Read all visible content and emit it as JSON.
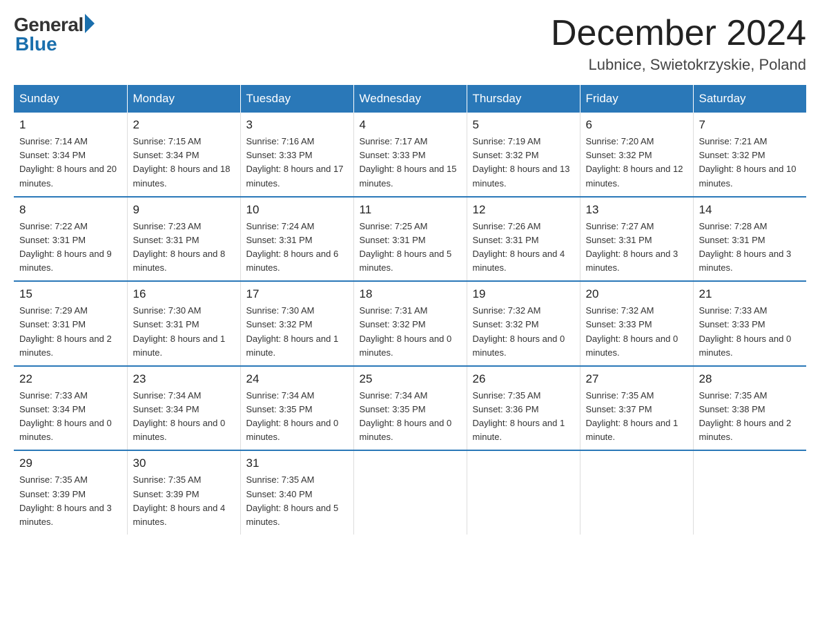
{
  "header": {
    "logo_general": "General",
    "logo_blue": "Blue",
    "title": "December 2024",
    "subtitle": "Lubnice, Swietokrzyskie, Poland"
  },
  "days_of_week": [
    "Sunday",
    "Monday",
    "Tuesday",
    "Wednesday",
    "Thursday",
    "Friday",
    "Saturday"
  ],
  "weeks": [
    [
      {
        "day": "1",
        "sunrise": "7:14 AM",
        "sunset": "3:34 PM",
        "daylight": "8 hours and 20 minutes."
      },
      {
        "day": "2",
        "sunrise": "7:15 AM",
        "sunset": "3:34 PM",
        "daylight": "8 hours and 18 minutes."
      },
      {
        "day": "3",
        "sunrise": "7:16 AM",
        "sunset": "3:33 PM",
        "daylight": "8 hours and 17 minutes."
      },
      {
        "day": "4",
        "sunrise": "7:17 AM",
        "sunset": "3:33 PM",
        "daylight": "8 hours and 15 minutes."
      },
      {
        "day": "5",
        "sunrise": "7:19 AM",
        "sunset": "3:32 PM",
        "daylight": "8 hours and 13 minutes."
      },
      {
        "day": "6",
        "sunrise": "7:20 AM",
        "sunset": "3:32 PM",
        "daylight": "8 hours and 12 minutes."
      },
      {
        "day": "7",
        "sunrise": "7:21 AM",
        "sunset": "3:32 PM",
        "daylight": "8 hours and 10 minutes."
      }
    ],
    [
      {
        "day": "8",
        "sunrise": "7:22 AM",
        "sunset": "3:31 PM",
        "daylight": "8 hours and 9 minutes."
      },
      {
        "day": "9",
        "sunrise": "7:23 AM",
        "sunset": "3:31 PM",
        "daylight": "8 hours and 8 minutes."
      },
      {
        "day": "10",
        "sunrise": "7:24 AM",
        "sunset": "3:31 PM",
        "daylight": "8 hours and 6 minutes."
      },
      {
        "day": "11",
        "sunrise": "7:25 AM",
        "sunset": "3:31 PM",
        "daylight": "8 hours and 5 minutes."
      },
      {
        "day": "12",
        "sunrise": "7:26 AM",
        "sunset": "3:31 PM",
        "daylight": "8 hours and 4 minutes."
      },
      {
        "day": "13",
        "sunrise": "7:27 AM",
        "sunset": "3:31 PM",
        "daylight": "8 hours and 3 minutes."
      },
      {
        "day": "14",
        "sunrise": "7:28 AM",
        "sunset": "3:31 PM",
        "daylight": "8 hours and 3 minutes."
      }
    ],
    [
      {
        "day": "15",
        "sunrise": "7:29 AM",
        "sunset": "3:31 PM",
        "daylight": "8 hours and 2 minutes."
      },
      {
        "day": "16",
        "sunrise": "7:30 AM",
        "sunset": "3:31 PM",
        "daylight": "8 hours and 1 minute."
      },
      {
        "day": "17",
        "sunrise": "7:30 AM",
        "sunset": "3:32 PM",
        "daylight": "8 hours and 1 minute."
      },
      {
        "day": "18",
        "sunrise": "7:31 AM",
        "sunset": "3:32 PM",
        "daylight": "8 hours and 0 minutes."
      },
      {
        "day": "19",
        "sunrise": "7:32 AM",
        "sunset": "3:32 PM",
        "daylight": "8 hours and 0 minutes."
      },
      {
        "day": "20",
        "sunrise": "7:32 AM",
        "sunset": "3:33 PM",
        "daylight": "8 hours and 0 minutes."
      },
      {
        "day": "21",
        "sunrise": "7:33 AM",
        "sunset": "3:33 PM",
        "daylight": "8 hours and 0 minutes."
      }
    ],
    [
      {
        "day": "22",
        "sunrise": "7:33 AM",
        "sunset": "3:34 PM",
        "daylight": "8 hours and 0 minutes."
      },
      {
        "day": "23",
        "sunrise": "7:34 AM",
        "sunset": "3:34 PM",
        "daylight": "8 hours and 0 minutes."
      },
      {
        "day": "24",
        "sunrise": "7:34 AM",
        "sunset": "3:35 PM",
        "daylight": "8 hours and 0 minutes."
      },
      {
        "day": "25",
        "sunrise": "7:34 AM",
        "sunset": "3:35 PM",
        "daylight": "8 hours and 0 minutes."
      },
      {
        "day": "26",
        "sunrise": "7:35 AM",
        "sunset": "3:36 PM",
        "daylight": "8 hours and 1 minute."
      },
      {
        "day": "27",
        "sunrise": "7:35 AM",
        "sunset": "3:37 PM",
        "daylight": "8 hours and 1 minute."
      },
      {
        "day": "28",
        "sunrise": "7:35 AM",
        "sunset": "3:38 PM",
        "daylight": "8 hours and 2 minutes."
      }
    ],
    [
      {
        "day": "29",
        "sunrise": "7:35 AM",
        "sunset": "3:39 PM",
        "daylight": "8 hours and 3 minutes."
      },
      {
        "day": "30",
        "sunrise": "7:35 AM",
        "sunset": "3:39 PM",
        "daylight": "8 hours and 4 minutes."
      },
      {
        "day": "31",
        "sunrise": "7:35 AM",
        "sunset": "3:40 PM",
        "daylight": "8 hours and 5 minutes."
      },
      null,
      null,
      null,
      null
    ]
  ]
}
